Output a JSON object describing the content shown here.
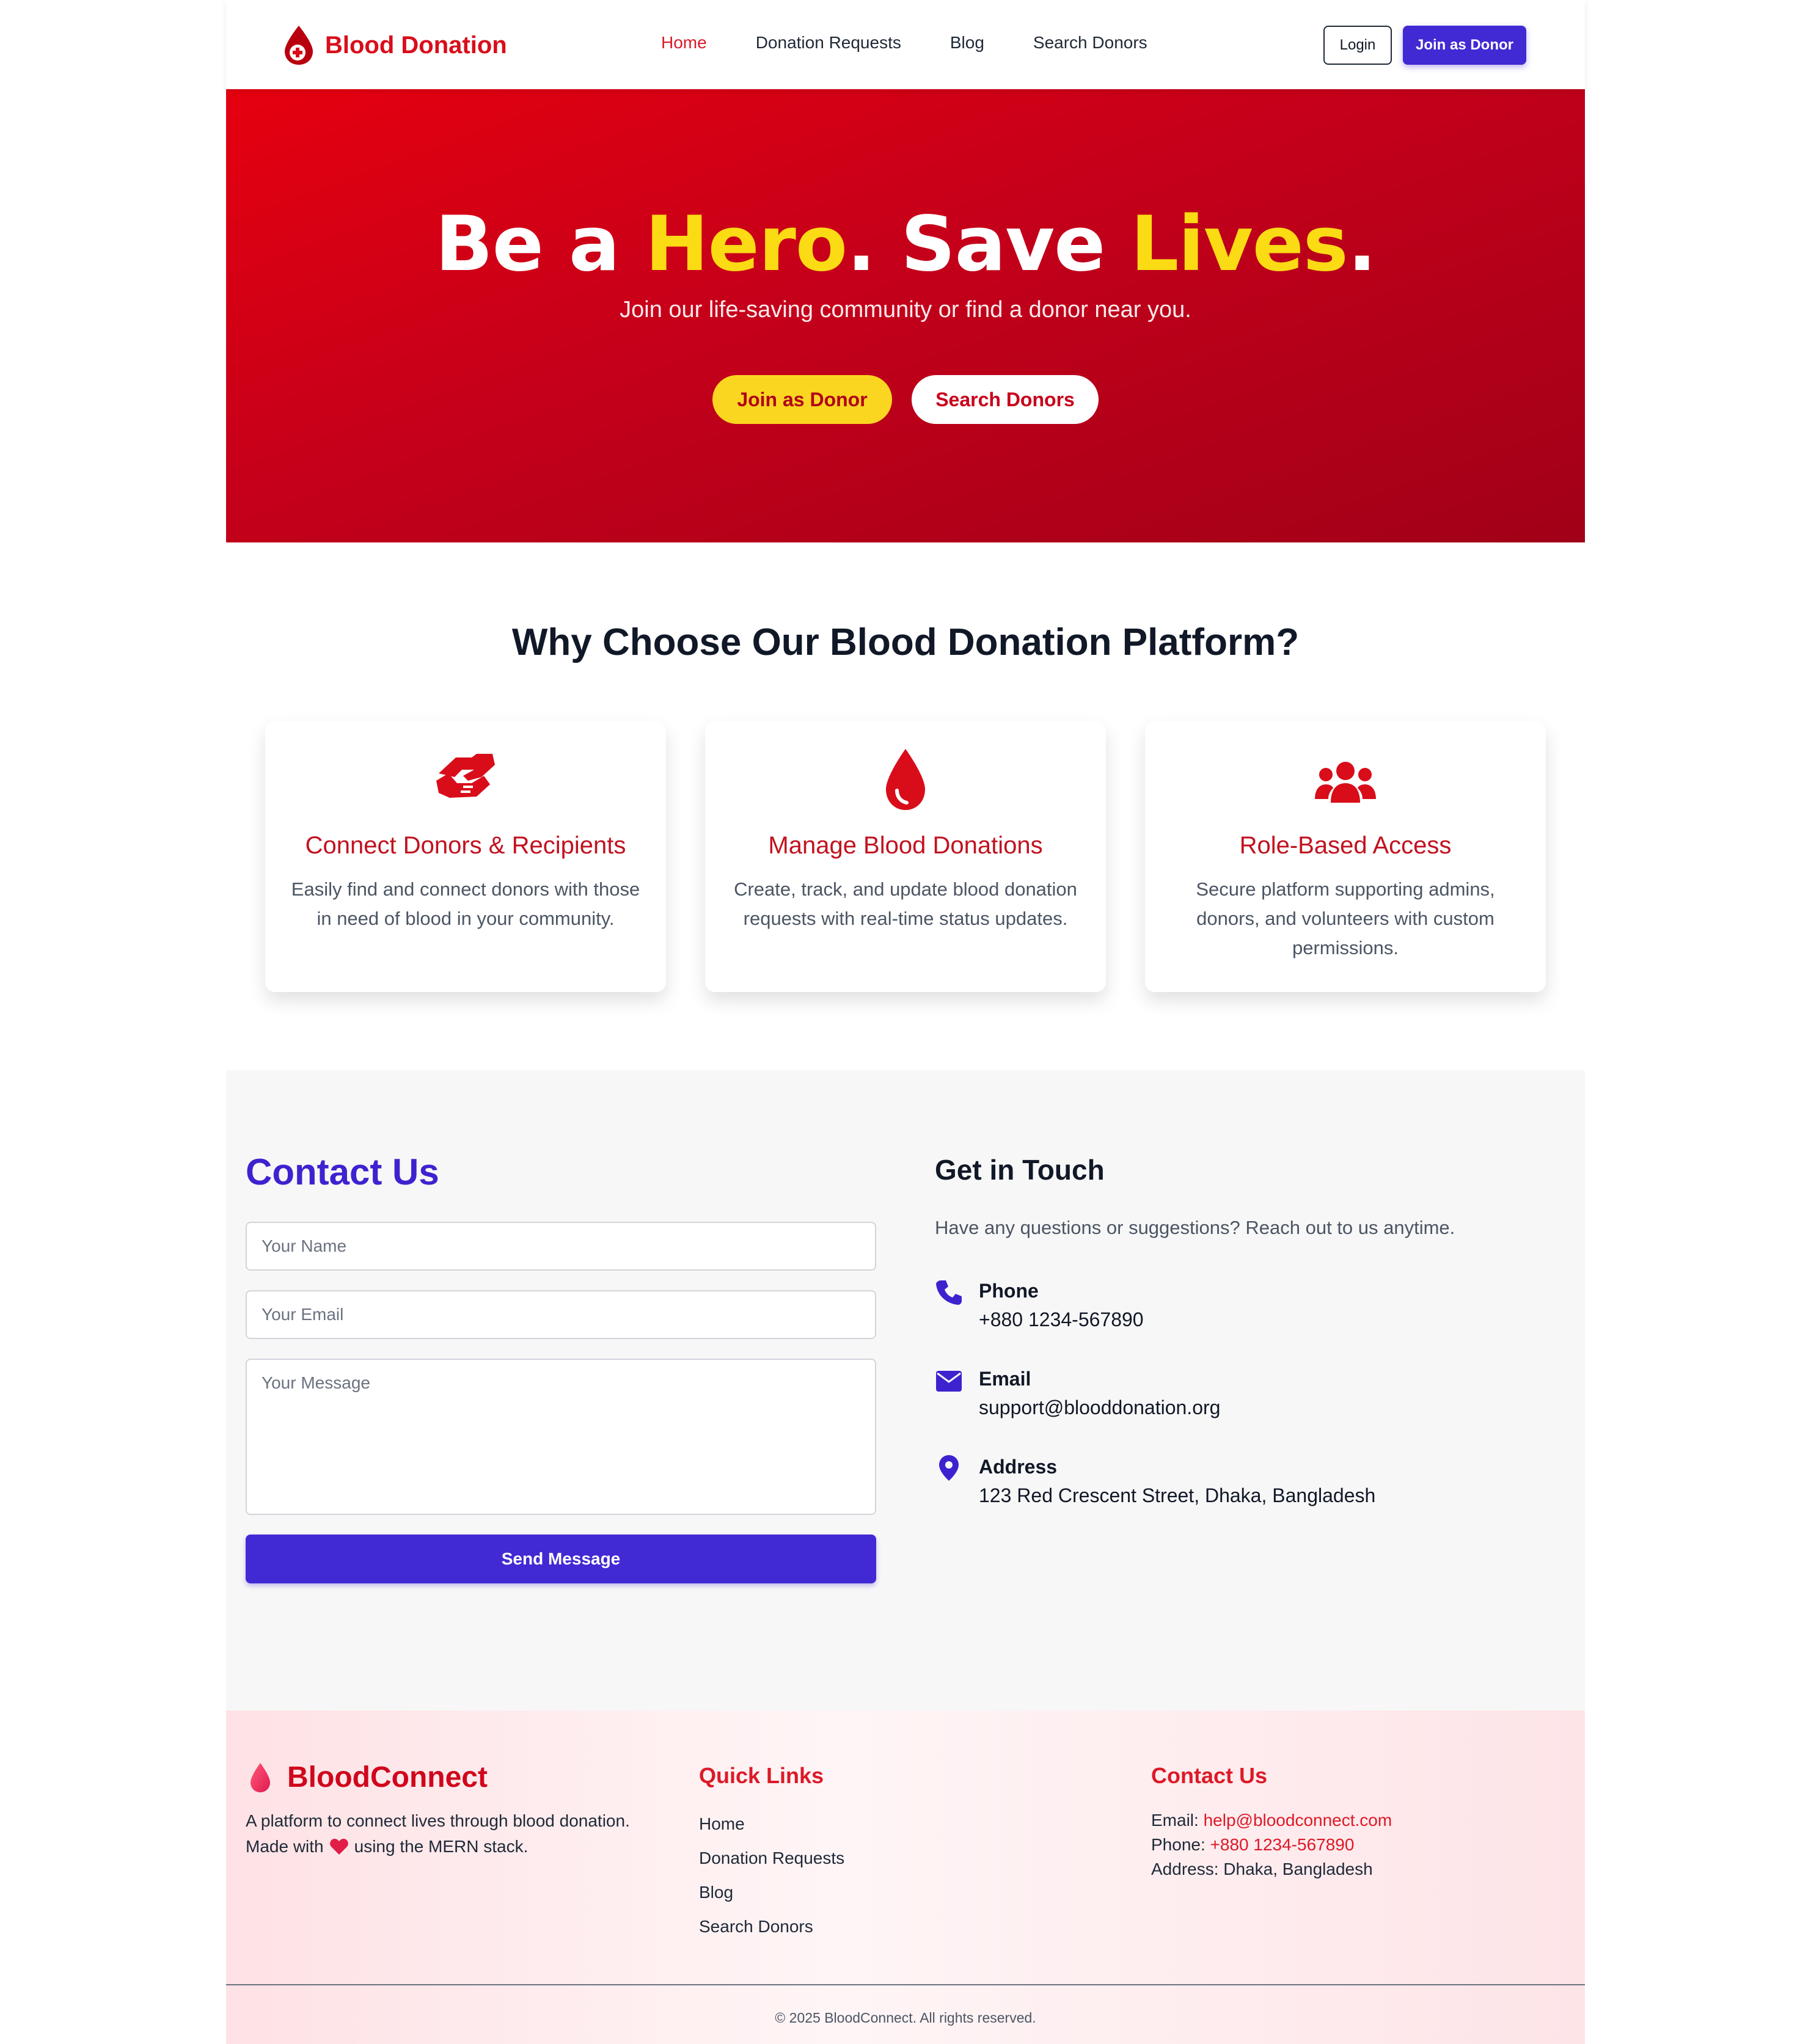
{
  "colors": {
    "brand_red": "#d90d1a",
    "accent_indigo": "#4129d3",
    "hero_yellow": "#fadb14",
    "contact_bg": "#f7f7f7"
  },
  "nav": {
    "brand": "Blood Donation",
    "brand_icon": "blood-drop-cross-icon",
    "links": [
      "Home",
      "Donation Requests",
      "Blog",
      "Search Donors"
    ],
    "active": "Home",
    "login": "Login",
    "join": "Join as Donor"
  },
  "hero": {
    "title_parts": [
      "Be a ",
      "Hero",
      ". Save ",
      "Lives",
      "."
    ],
    "subtitle": "Join our life-saving community or find a donor near you.",
    "btn_join": "Join as Donor",
    "btn_search": "Search Donors"
  },
  "features": {
    "title": "Why Choose Our Blood Donation Platform?",
    "cards": [
      {
        "icon": "handshake-icon",
        "title": "Connect Donors & Recipients",
        "desc": "Easily find and connect donors with those in need of blood in your community."
      },
      {
        "icon": "blood-drop-icon",
        "title": "Manage Blood Donations",
        "desc": "Create, track, and update blood donation requests with real-time status updates."
      },
      {
        "icon": "users-icon",
        "title": "Role-Based Access",
        "desc": "Secure platform supporting admins, donors, and volunteers with custom permissions."
      }
    ]
  },
  "contact": {
    "title": "Contact Us",
    "name_placeholder": "Your Name",
    "email_placeholder": "Your Email",
    "message_placeholder": "Your Message",
    "send": "Send Message",
    "touch_title": "Get in Touch",
    "touch_sub": "Have any questions or suggestions? Reach out to us anytime.",
    "phone_label": "Phone",
    "phone": "+880 1234-567890",
    "email_label": "Email",
    "email": "support@blooddonation.org",
    "address_label": "Address",
    "address": "123 Red Crescent Street, Dhaka, Bangladesh"
  },
  "footer": {
    "brand": "BloodConnect",
    "desc_line1": "A platform to connect lives through blood donation.",
    "desc_made": "Made with",
    "desc_stack": "using the MERN stack.",
    "quick_title": "Quick Links",
    "quick_links": [
      "Home",
      "Donation Requests",
      "Blog",
      "Search Donors"
    ],
    "contact_title": "Contact Us",
    "email_label": "Email:",
    "email": "help@bloodconnect.com",
    "phone_label": "Phone:",
    "phone": "+880 1234-567890",
    "address_label": "Address:",
    "address": "Dhaka, Bangladesh",
    "copyright": "© 2025 BloodConnect. All rights reserved."
  }
}
